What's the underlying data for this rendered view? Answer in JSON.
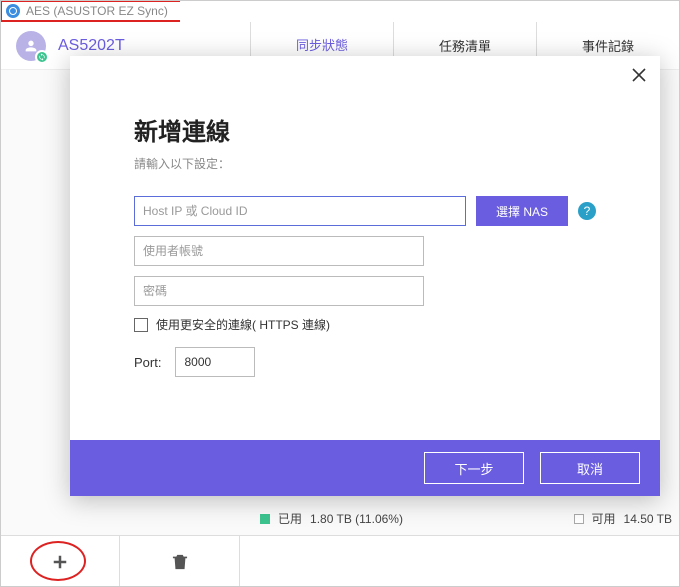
{
  "app": {
    "title": "AES (ASUSTOR EZ Sync)"
  },
  "device": {
    "name": "AS5202T"
  },
  "tabs": {
    "status": "同步狀態",
    "tasks": "任務清單",
    "events": "事件記錄"
  },
  "storage": {
    "used_label": "已用",
    "used_value": "1.80 TB (11.06%)",
    "free_label": "可用",
    "free_value": "14.50 TB"
  },
  "dialog": {
    "title": "新增連線",
    "subtitle": "請輸入以下設定：",
    "host_placeholder": "Host IP 或 Cloud ID",
    "select_nas": "選擇 NAS",
    "user_placeholder": "使用者帳號",
    "pass_placeholder": "密碼",
    "secure_label": "使用更安全的連線( HTTPS 連線)",
    "port_label": "Port:",
    "port_value": "8000",
    "next": "下一步",
    "cancel": "取消"
  }
}
